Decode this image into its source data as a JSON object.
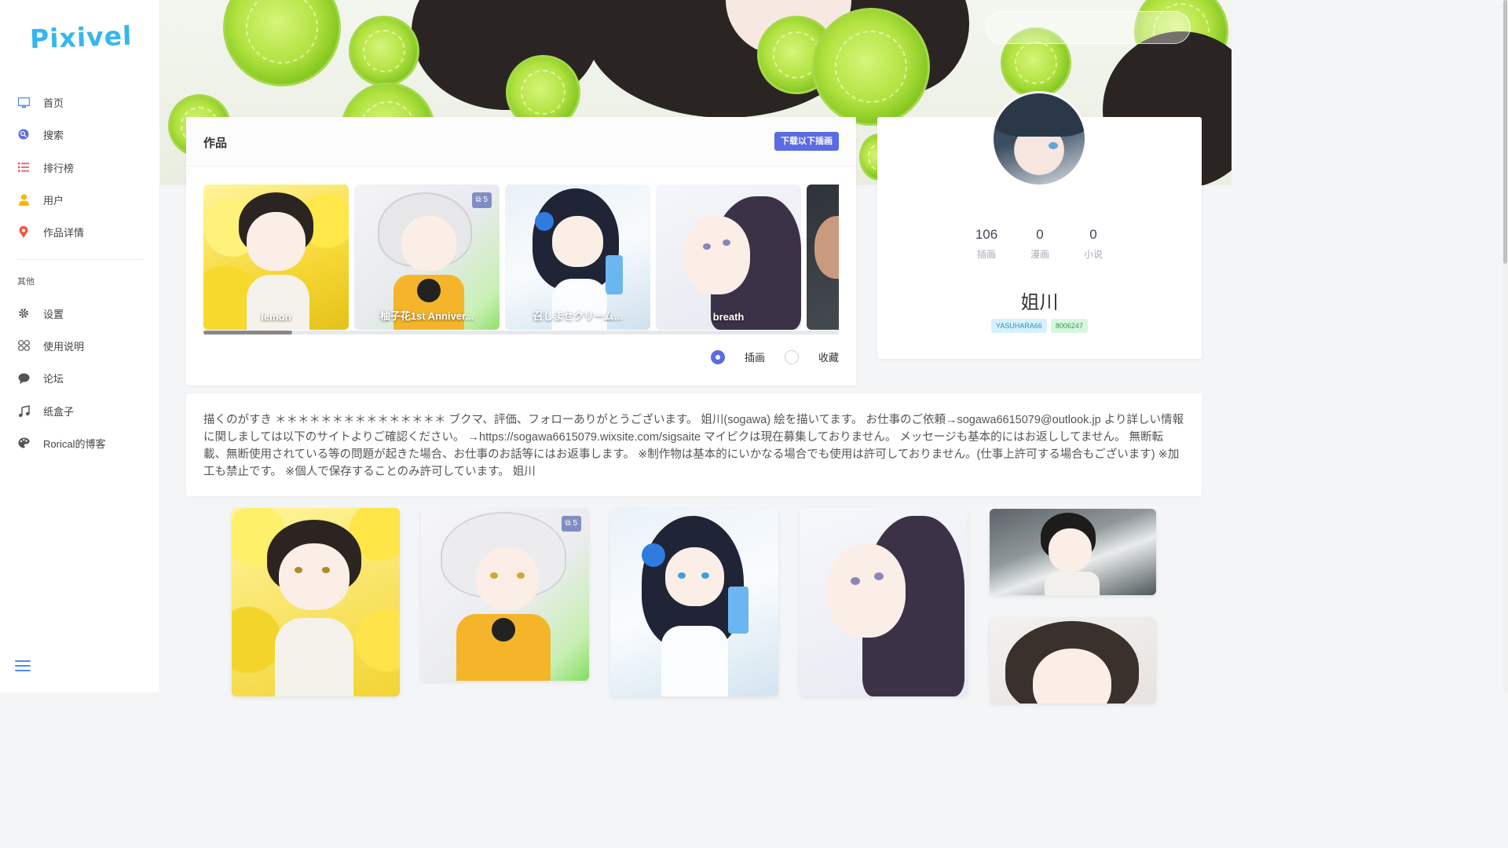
{
  "app": {
    "logo": "Pixivel"
  },
  "nav": {
    "items": [
      {
        "label": "首页",
        "icon": "monitor-icon",
        "color": "#4c8bf5"
      },
      {
        "label": "搜索",
        "icon": "search-icon",
        "color": "#5b6be3"
      },
      {
        "label": "排行榜",
        "icon": "list-icon",
        "color": "#ef4f5f"
      },
      {
        "label": "用户",
        "icon": "user-icon",
        "color": "#f5b800"
      },
      {
        "label": "作品详情",
        "icon": "map-pin-icon",
        "color": "#ef5a3c"
      }
    ],
    "section_title": "其他",
    "other_items": [
      {
        "label": "设置",
        "icon": "gear-icon"
      },
      {
        "label": "使用说明",
        "icon": "manual-icon"
      },
      {
        "label": "论坛",
        "icon": "chat-icon"
      },
      {
        "label": "纸盒子",
        "icon": "music-icon"
      },
      {
        "label": "Rorical的博客",
        "icon": "palette-icon"
      }
    ]
  },
  "works": {
    "title": "作品",
    "download_button": "下载以下插画",
    "thumbnails": [
      {
        "title": "lemon",
        "badge": ""
      },
      {
        "title": "柚子花1st Anniver...",
        "badge": "5"
      },
      {
        "title": "召しませクリーム...",
        "badge": ""
      },
      {
        "title": "breath",
        "badge": ""
      }
    ],
    "scroll_fraction": 0.14,
    "filter_options": [
      {
        "label": "插画",
        "selected": true
      },
      {
        "label": "收藏",
        "selected": false
      }
    ]
  },
  "profile": {
    "stats": [
      {
        "value": "106",
        "label": "插画"
      },
      {
        "value": "0",
        "label": "漫画"
      },
      {
        "value": "0",
        "label": "小说"
      }
    ],
    "name": "姐川",
    "tags": [
      "YASUHARA66",
      "8006247"
    ]
  },
  "bio": "描くのがすき ＊＊＊＊＊＊＊＊＊＊＊＊＊＊＊ ブクマ、評価、フォローありがとうございます。 姐川(sogawa) 絵を描いてます。 お仕事のご依頼→sogawa6615079@outlook.jp より詳しい情報に関しましては以下のサイトよりご確認ください。 →https://sogawa6615079.wixsite.com/sigsaite マイピクは現在募集しておりません。 メッセージも基本的にはお返ししてません。 無断転載、無断使用されている等の問題が起きた場合、お仕事のお話等にはお返事します。 ※制作物は基本的にいかなる場合でも使用は許可しておりません。(仕事上許可する場合もございます) ※加工も禁止です。 ※個人で保存することのみ許可しています。 姐川",
  "gallery": {
    "items": [
      {
        "name": "lemon",
        "badge": ""
      },
      {
        "name": "anniversary",
        "badge": "5"
      },
      {
        "name": "cream-soda",
        "badge": ""
      },
      {
        "name": "breath",
        "badge": ""
      },
      {
        "name": "palm-leaves",
        "badge": ""
      },
      {
        "name": "portrait",
        "badge": ""
      }
    ]
  },
  "colors": {
    "accent": "#5b6be3",
    "logo": "#35b6ef"
  }
}
